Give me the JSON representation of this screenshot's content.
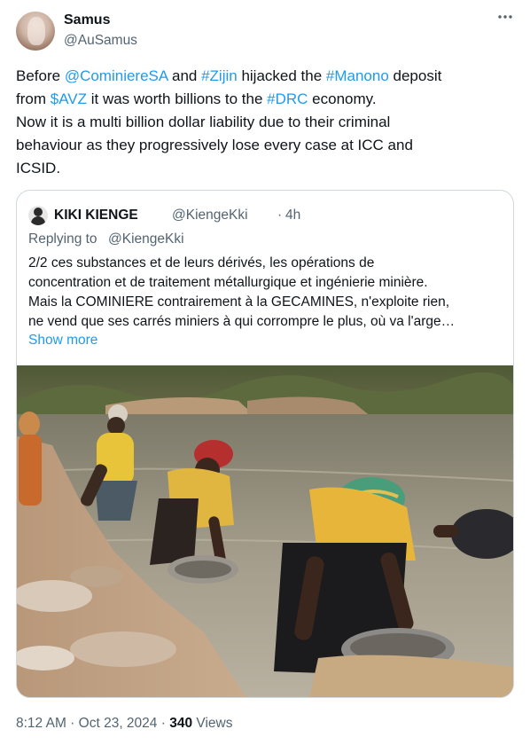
{
  "author": {
    "name": "Samus",
    "handle": "@AuSamus"
  },
  "more_icon": "more-horizontal-icon",
  "tweet": {
    "lines": [
      [
        {
          "text": "Before ",
          "link": false
        },
        {
          "text": "@CominiereSA",
          "link": true
        },
        {
          "text": " and ",
          "link": false
        },
        {
          "text": "#Zijin",
          "link": true
        },
        {
          "text": " hijacked the ",
          "link": false
        },
        {
          "text": "#Manono",
          "link": true
        },
        {
          "text": " deposit",
          "link": false
        }
      ],
      [
        {
          "text": "from ",
          "link": false
        },
        {
          "text": "$AVZ",
          "link": true
        },
        {
          "text": " it was worth billions to the ",
          "link": false
        },
        {
          "text": "#DRC",
          "link": true
        },
        {
          "text": " economy.",
          "link": false
        }
      ],
      [
        {
          "text": "Now it is a multi billion dollar liability due to their criminal",
          "link": false
        }
      ],
      [
        {
          "text": "behaviour as they progressively lose every case at ICC and",
          "link": false
        }
      ],
      [
        {
          "text": "ICSID.",
          "link": false
        }
      ]
    ]
  },
  "quote": {
    "name": "KIKI KIENGE",
    "handle": "@KiengeKki",
    "separator": "·",
    "time": "4h",
    "replying_prefix": "Replying to",
    "replying_to": "@KiengeKki",
    "lines": [
      "2/2 ces substances et de leurs dérivés, les opérations de",
      "concentration et de traitement métallurgique et ingénierie minière.",
      "Mais la COMINIERE contrairement à la GECAMINES, n'exploite rien,",
      "ne vend que ses carrés miniers à qui corrompre le plus, où va l'arge…"
    ],
    "show_more": "Show more"
  },
  "footer": {
    "time": "8:12 AM",
    "sep1": " · ",
    "date": "Oct 23, 2024",
    "sep2": " · ",
    "views_count": "340",
    "views_label": " Views"
  }
}
